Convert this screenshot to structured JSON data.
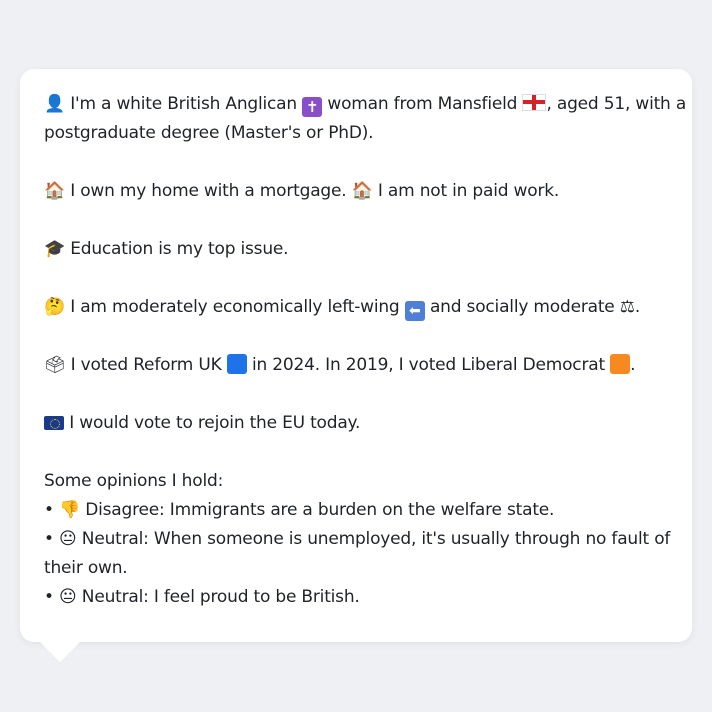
{
  "profile": {
    "intro_line1": "I'm a white British Anglican",
    "intro_mid": "woman from Mansfield",
    "intro_end": ", aged 51, with a",
    "intro_line2": "postgraduate degree (Master's or PhD).",
    "home_a": "I own my home with a mortgage.",
    "home_b": "I am not in paid work.",
    "issue": "Education is my top issue.",
    "econ_a": "I am moderately economically left-wing",
    "econ_b": "and socially moderate",
    "econ_c": ".",
    "vote_a": "I voted Reform UK",
    "vote_b": "in 2024. In 2019, I voted Liberal Democrat",
    "vote_c": ".",
    "eu": "I would vote to rejoin the EU today.",
    "opinions_title": "Some opinions I hold:",
    "op1": "Disagree: Immigrants are a burden on the welfare state.",
    "op2_line1": "Neutral: When someone is unemployed, it's usually through no fault of",
    "op2_line2": "their own.",
    "op3": "Neutral: I feel proud to be British."
  },
  "icons": {
    "person": "bust-in-silhouette-icon",
    "religion": "latin-cross-icon",
    "flag": "england-flag-icon",
    "house": "house-icon",
    "grad": "graduation-cap-icon",
    "thinking": "thinking-face-icon",
    "left_arrow": "left-arrow-icon",
    "scales": "balance-scale-icon",
    "ballot": "ballot-box-icon",
    "reform_color": "#1e73e8",
    "libdem_color": "#f6891f",
    "eu": "eu-flag-icon",
    "thumbs_down": "thumbs-down-icon",
    "neutral": "neutral-face-icon"
  },
  "glyphs": {
    "bullet": "•",
    "person": "👤",
    "cross": "✝",
    "house": "🏠",
    "grad": "🎓",
    "thinking": "🤔",
    "arrow": "⬅",
    "scales": "⚖",
    "ballot": "🗳",
    "thumbs_down": "👎",
    "neutral": "😐"
  }
}
